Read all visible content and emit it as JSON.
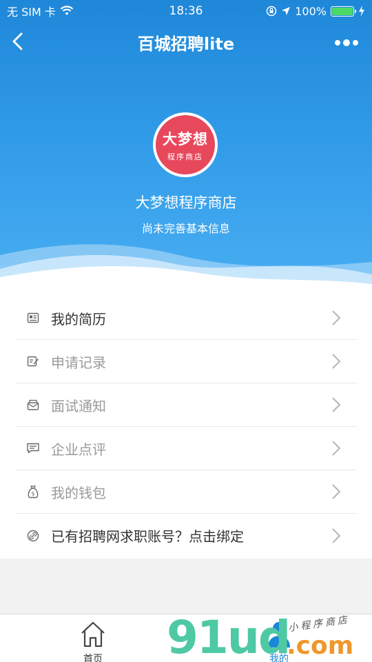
{
  "status_bar": {
    "carrier": "无 SIM 卡",
    "time": "18:36",
    "battery": "100%"
  },
  "nav": {
    "title": "百城招聘lite"
  },
  "profile": {
    "avatar_line1": "大梦想",
    "avatar_line2": "程序商店",
    "name": "大梦想程序商店",
    "subtitle": "尚未完善基本信息"
  },
  "menu": {
    "items": [
      {
        "label": "我的简历",
        "icon": "resume-icon"
      },
      {
        "label": "申请记录",
        "icon": "edit-record-icon"
      },
      {
        "label": "面试通知",
        "icon": "mail-icon"
      },
      {
        "label": "企业点评",
        "icon": "comment-icon"
      },
      {
        "label": "我的钱包",
        "icon": "money-bag-icon"
      },
      {
        "label": "已有招聘网求职账号？点击绑定",
        "icon": "link-icon"
      }
    ]
  },
  "tabs": {
    "home": "首页",
    "mine": "我的"
  },
  "watermark": {
    "main": "91ud",
    "suffix": ".com",
    "tagline": "小程序商店"
  },
  "colors": {
    "header_blue": "#2f9ae8",
    "avatar_red": "#e8485c",
    "active_tab": "#1a87d8",
    "battery_green": "#4cd964"
  }
}
